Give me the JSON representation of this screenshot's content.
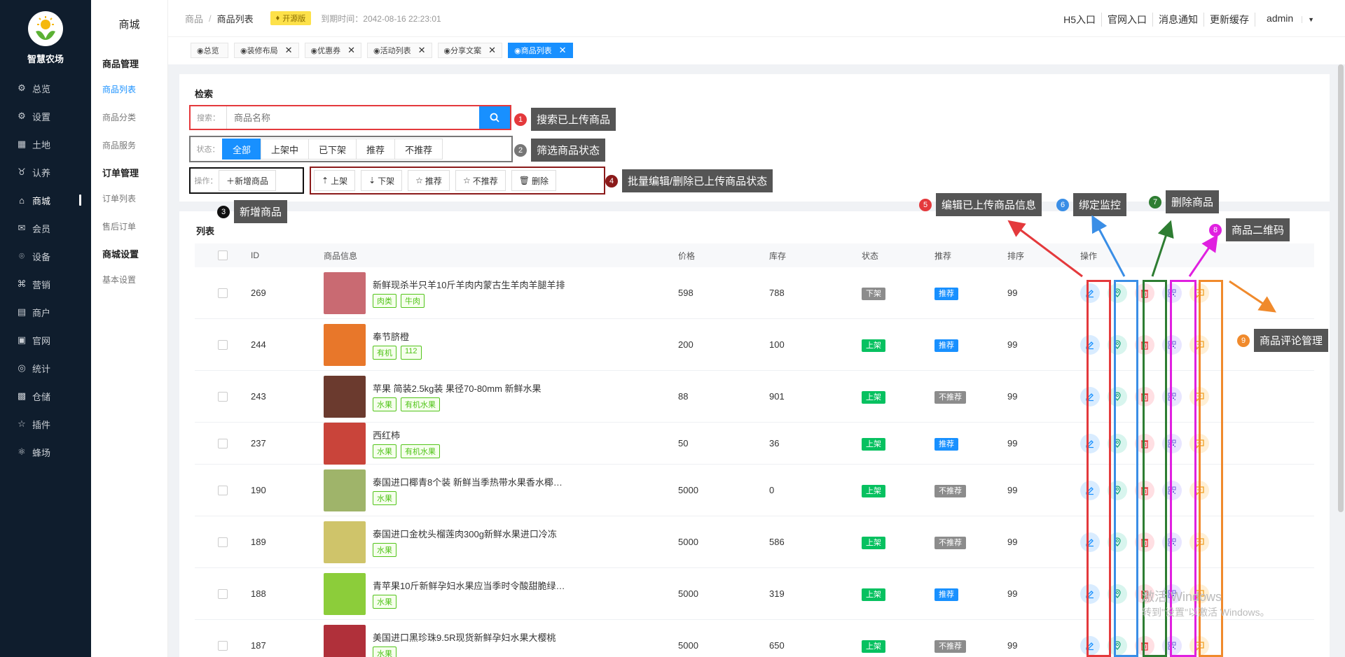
{
  "brand": {
    "name": "智慧农场"
  },
  "nav": [
    {
      "label": "总览",
      "icon": "dashboard-icon"
    },
    {
      "label": "设置",
      "icon": "gear-icon"
    },
    {
      "label": "土地",
      "icon": "land-icon"
    },
    {
      "label": "认养",
      "icon": "adopt-icon"
    },
    {
      "label": "商城",
      "icon": "shop-icon",
      "active": true
    },
    {
      "label": "会员",
      "icon": "member-icon"
    },
    {
      "label": "设备",
      "icon": "device-icon"
    },
    {
      "label": "营销",
      "icon": "marketing-icon"
    },
    {
      "label": "商户",
      "icon": "merchant-icon"
    },
    {
      "label": "官网",
      "icon": "website-icon"
    },
    {
      "label": "统计",
      "icon": "stats-icon"
    },
    {
      "label": "仓储",
      "icon": "warehouse-icon"
    },
    {
      "label": "插件",
      "icon": "plugin-icon"
    },
    {
      "label": "蜂场",
      "icon": "bee-icon"
    }
  ],
  "subnav": {
    "title": "商城",
    "groups": [
      {
        "title": "商品管理",
        "items": [
          "商品列表",
          "商品分类",
          "商品服务"
        ]
      },
      {
        "title": "订单管理",
        "items": [
          "订单列表",
          "售后订单"
        ]
      },
      {
        "title": "商城设置",
        "items": [
          "基本设置"
        ]
      }
    ]
  },
  "header": {
    "breadcrumb": [
      "商品",
      "商品列表"
    ],
    "edition": "开源版",
    "expire": "到期时间：2042-08-16 22:23:01",
    "links": [
      "H5入口",
      "官网入口",
      "消息通知",
      "更新缓存",
      "admin"
    ]
  },
  "tabs": [
    {
      "label": "◉总览",
      "closable": false
    },
    {
      "label": "◉装修布局",
      "closable": true
    },
    {
      "label": "◉优惠券",
      "closable": true
    },
    {
      "label": "◉活动列表",
      "closable": true
    },
    {
      "label": "◉分享文案",
      "closable": true
    },
    {
      "label": "◉商品列表",
      "closable": true,
      "active": true
    }
  ],
  "search": {
    "title": "检索",
    "label": "搜索：",
    "placeholder": "商品名称",
    "status_label": "状态：",
    "status_options": [
      "全部",
      "上架中",
      "已下架",
      "推荐",
      "不推荐"
    ],
    "op_label": "操作：",
    "add_button": "＋新增商品",
    "batch_buttons": [
      "上架",
      "下架",
      "推荐",
      "不推荐",
      "删除"
    ]
  },
  "annotations": [
    {
      "num": "1",
      "text": "搜索已上传商品",
      "color": "#e4393c"
    },
    {
      "num": "2",
      "text": "筛选商品状态",
      "color": "#777777"
    },
    {
      "num": "3",
      "text": "新增商品",
      "color": "#111111"
    },
    {
      "num": "4",
      "text": "批量编辑/删除已上传商品状态",
      "color": "#8b1a1a"
    },
    {
      "num": "5",
      "text": "编辑已上传商品信息",
      "color": "#e4393c"
    },
    {
      "num": "6",
      "text": "绑定监控",
      "color": "#3a8ee6"
    },
    {
      "num": "7",
      "text": "删除商品",
      "color": "#2e7d32"
    },
    {
      "num": "8",
      "text": "商品二维码",
      "color": "#e020e0"
    },
    {
      "num": "9",
      "text": "商品评论管理",
      "color": "#f08a2c"
    }
  ],
  "list": {
    "title": "列表",
    "columns": [
      "ID",
      "商品信息",
      "价格",
      "库存",
      "状态",
      "推荐",
      "排序",
      "操作"
    ],
    "rows": [
      {
        "id": "269",
        "name": "新鲜现杀半只羊10斤羊肉内蒙古生羊肉羊腿羊排",
        "tags": [
          "肉类",
          "牛肉"
        ],
        "price": "598",
        "stock": "788",
        "status": "下架",
        "status_color": "grey",
        "rec": "推荐",
        "rec_color": "blue",
        "sort": "99",
        "thumb": "#c96a72"
      },
      {
        "id": "244",
        "name": "奉节脐橙",
        "tags": [
          "有机",
          "112"
        ],
        "price": "200",
        "stock": "100",
        "status": "上架",
        "status_color": "green",
        "rec": "推荐",
        "rec_color": "blue",
        "sort": "99",
        "thumb": "#e8772a"
      },
      {
        "id": "243",
        "name": "苹果 简装2.5kg装 果径70-80mm 新鲜水果",
        "tags": [
          "水果",
          "有机水果"
        ],
        "price": "88",
        "stock": "901",
        "status": "上架",
        "status_color": "green",
        "rec": "不推荐",
        "rec_color": "grey",
        "sort": "99",
        "thumb": "#6b3a2e"
      },
      {
        "id": "237",
        "name": "西红柿",
        "tags": [
          "水果",
          "有机水果"
        ],
        "price": "50",
        "stock": "36",
        "status": "上架",
        "status_color": "green",
        "rec": "推荐",
        "rec_color": "blue",
        "sort": "99",
        "thumb": "#c9443a"
      },
      {
        "id": "190",
        "name": "泰国进口椰青8个装 新鲜当季热带水果香水椰…",
        "tags": [
          "水果"
        ],
        "price": "5000",
        "stock": "0",
        "status": "上架",
        "status_color": "green",
        "rec": "不推荐",
        "rec_color": "grey",
        "sort": "99",
        "thumb": "#9fb46a"
      },
      {
        "id": "189",
        "name": "泰国进口金枕头榴莲肉300g新鲜水果进口冷冻",
        "tags": [
          "水果"
        ],
        "price": "5000",
        "stock": "586",
        "status": "上架",
        "status_color": "green",
        "rec": "不推荐",
        "rec_color": "grey",
        "sort": "99",
        "thumb": "#cfc46a"
      },
      {
        "id": "188",
        "name": "青苹果10斤新鲜孕妇水果应当季时令酸甜脆绿…",
        "tags": [
          "水果"
        ],
        "price": "5000",
        "stock": "319",
        "status": "上架",
        "status_color": "green",
        "rec": "推荐",
        "rec_color": "blue",
        "sort": "99",
        "thumb": "#8ccd3a"
      },
      {
        "id": "187",
        "name": "美国进口黑珍珠9.5R现货新鲜孕妇水果大樱桃",
        "tags": [
          "水果"
        ],
        "price": "5000",
        "stock": "650",
        "status": "上架",
        "status_color": "green",
        "rec": "不推荐",
        "rec_color": "grey",
        "sort": "99",
        "thumb": "#b0303a"
      }
    ]
  },
  "watermark": {
    "line1": "激活 Windows",
    "line2": "转到\"设置\"以激活 Windows。"
  }
}
